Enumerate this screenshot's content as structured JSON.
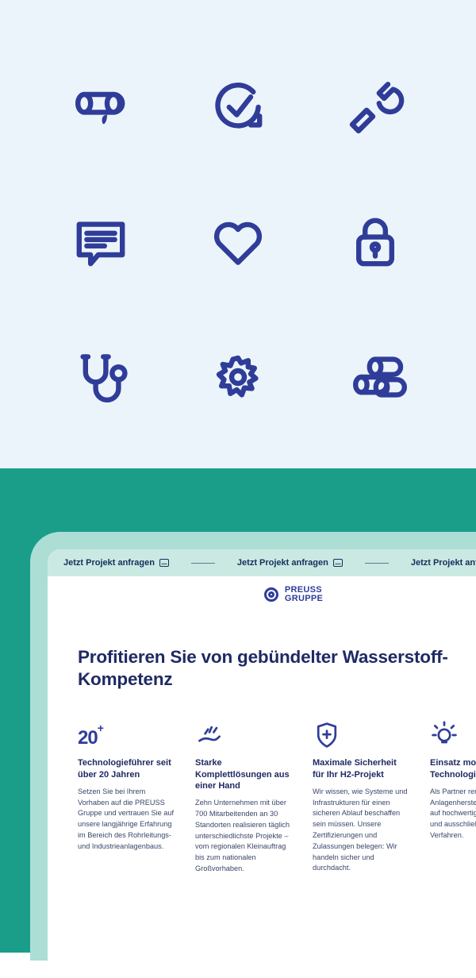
{
  "colors": {
    "brand": "#2f3d99",
    "teal": "#1a9e8a",
    "iconPanel": "#ecf4fb",
    "tickerBg": "#cbe9e3"
  },
  "icon_grid": [
    "pipe-drop-icon",
    "check-circle-arrow-icon",
    "wrench-icon",
    "chat-note-icon",
    "heart-icon",
    "lock-icon",
    "stethoscope-icon",
    "gear-icon",
    "pipes-stack-icon"
  ],
  "ticker": {
    "label": "Jetzt Projekt anfragen",
    "repeat": 3
  },
  "brand": {
    "line1": "PREUSS",
    "line2": "GRUPPE"
  },
  "headline": "Profitieren Sie von gebündelter Wasserstoff-Kompetenz",
  "features": [
    {
      "icon": "stat",
      "stat": "20",
      "stat_plus": "+",
      "title": "Technologieführer seit über 20 Jahren",
      "body": "Setzen Sie bei Ihrem Vorhaben auf die PREUSS Gruppe und vertrauen Sie auf unsere langjährige Erfahrung im Bereich des Rohrleitungs- und Industrieanlagenbaus."
    },
    {
      "icon": "hand-icon",
      "title": "Starke Komplettlösungen aus einer Hand",
      "body": "Zehn Unternehmen mit über 700 Mitarbeitenden an 30 Standorten realisieren täglich unterschiedlichste Projekte – vom regionalen Kleinauftrag bis zum nationalen Großvorhaben."
    },
    {
      "icon": "shield-plus-icon",
      "title": "Maximale Sicherheit für Ihr H2-Projekt",
      "body": "Wir wissen, wie Systeme und Infrastrukturen für einen sicheren Ablauf beschaffen sein müssen. Unsere Zertifizierungen und Zulassungen belegen: Wir handeln sicher und durchdacht."
    },
    {
      "icon": "bulb-icon",
      "title": "Einsatz modernster Technologien",
      "body": "Als Partner renommierter Anlagenhersteller setzen wir auf hochwertige Ressourcen und ausschließlich modernste Verfahren."
    }
  ]
}
